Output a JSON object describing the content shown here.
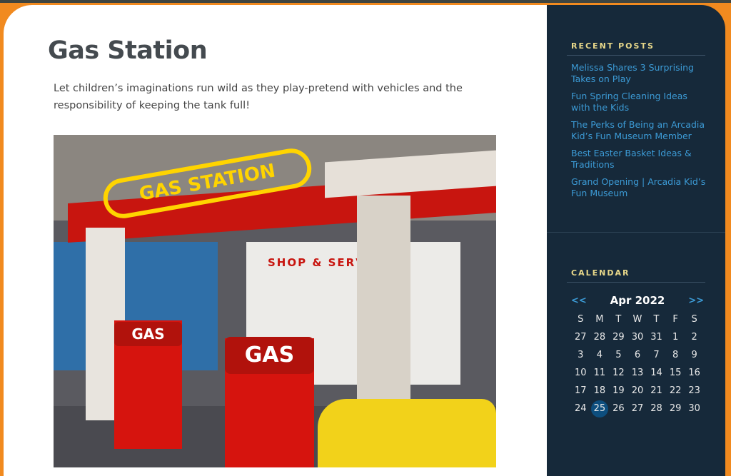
{
  "page": {
    "title": "Gas Station",
    "intro": "Let children’s imaginations run wild as they play-pretend with vehicles and the responsibility of keeping the tank full!"
  },
  "photo": {
    "sign": "GAS STATION",
    "shop_sign": "SHOP & SERV",
    "pump1": "GAS",
    "pump2": "GAS"
  },
  "sidebar": {
    "recent_title": "RECENT POSTS",
    "posts": [
      "Melissa Shares 3 Surprising Takes on Play",
      "Fun Spring Cleaning Ideas with the Kids",
      "The Perks of Being an Arcadia Kid’s Fun Museum Member",
      "Best Easter Basket Ideas & Traditions",
      "Grand Opening | Arcadia Kid’s Fun Museum"
    ],
    "calendar_title": "CALENDAR",
    "calendar": {
      "prev": "<<",
      "next": ">>",
      "month": "Apr 2022",
      "days": [
        "S",
        "M",
        "T",
        "W",
        "T",
        "F",
        "S"
      ],
      "weeks": [
        [
          "27",
          "28",
          "29",
          "30",
          "31",
          "1",
          "2"
        ],
        [
          "3",
          "4",
          "5",
          "6",
          "7",
          "8",
          "9"
        ],
        [
          "10",
          "11",
          "12",
          "13",
          "14",
          "15",
          "16"
        ],
        [
          "17",
          "18",
          "19",
          "20",
          "21",
          "22",
          "23"
        ],
        [
          "24",
          "25",
          "26",
          "27",
          "28",
          "29",
          "30"
        ]
      ],
      "today": "25"
    }
  },
  "colors": {
    "accent": "#f18a1f",
    "sidebar": "#16293a",
    "link": "#3c9bd6",
    "heading": "#e8d88a"
  }
}
